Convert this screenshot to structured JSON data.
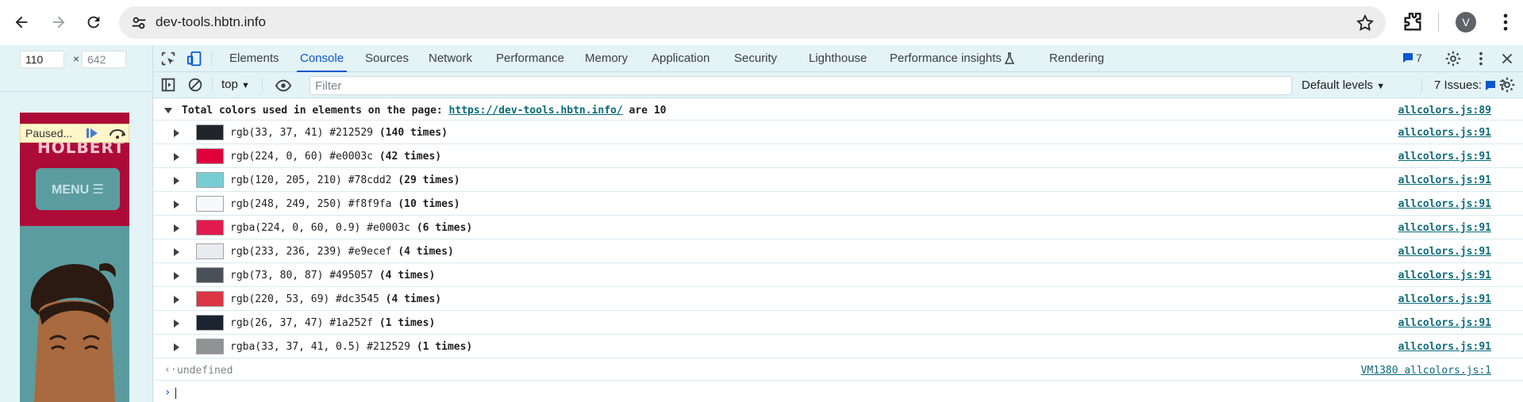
{
  "browser": {
    "url": "dev-tools.hbtn.info",
    "avatar_letter": "V"
  },
  "device_toolbar": {
    "width": "110",
    "height": "642",
    "times": "×"
  },
  "page": {
    "brand": "HOLBERT",
    "menu_label": "MENU ☰",
    "paused_label": "Paused..."
  },
  "devtools": {
    "tabs": [
      "Elements",
      "Console",
      "Sources",
      "Network",
      "Performance",
      "Memory",
      "Application",
      "Security",
      "Lighthouse",
      "Performance insights",
      "Rendering"
    ],
    "active_tab": "Console",
    "message_count": "7",
    "context": "top",
    "filter_placeholder": "Filter",
    "levels": "Default levels",
    "issues_label": "7 Issues:",
    "issues_count": "7"
  },
  "console": {
    "header": {
      "prefix": "Total colors used in elements on the page: ",
      "url": "https://dev-tools.hbtn.info/",
      "suffix": " are 10",
      "source": "allcolors.js:89"
    },
    "rows": [
      {
        "color": "#212529",
        "text": "rgb(33, 37, 41) #212529 ",
        "count": "(140 times)",
        "source": "allcolors.js:91"
      },
      {
        "color": "#e0003c",
        "text": "rgb(224, 0, 60) #e0003c ",
        "count": "(42 times)",
        "source": "allcolors.js:91"
      },
      {
        "color": "#78cdd2",
        "text": "rgb(120, 205, 210) #78cdd2 ",
        "count": "(29 times)",
        "source": "allcolors.js:91"
      },
      {
        "color": "#f8f9fa",
        "text": "rgb(248, 249, 250) #f8f9fa ",
        "count": "(10 times)",
        "source": "allcolors.js:91"
      },
      {
        "color": "#e31a4f",
        "text": "rgba(224, 0, 60, 0.9) #e0003c ",
        "count": "(6 times)",
        "source": "allcolors.js:91"
      },
      {
        "color": "#e9ecef",
        "text": "rgb(233, 236, 239) #e9ecef ",
        "count": "(4 times)",
        "source": "allcolors.js:91"
      },
      {
        "color": "#495057",
        "text": "rgb(73, 80, 87) #495057 ",
        "count": "(4 times)",
        "source": "allcolors.js:91"
      },
      {
        "color": "#dc3545",
        "text": "rgb(220, 53, 69) #dc3545 ",
        "count": "(4 times)",
        "source": "allcolors.js:91"
      },
      {
        "color": "#1a252f",
        "text": "rgb(26, 37, 47) #1a252f ",
        "count": "(1 times)",
        "source": "allcolors.js:91"
      },
      {
        "color": "#909294",
        "text": "rgba(33, 37, 41, 0.5) #212529 ",
        "count": "(1 times)",
        "source": "allcolors.js:91"
      }
    ],
    "return_value": "undefined",
    "return_source": "VM1380 allcolors.js:1"
  }
}
